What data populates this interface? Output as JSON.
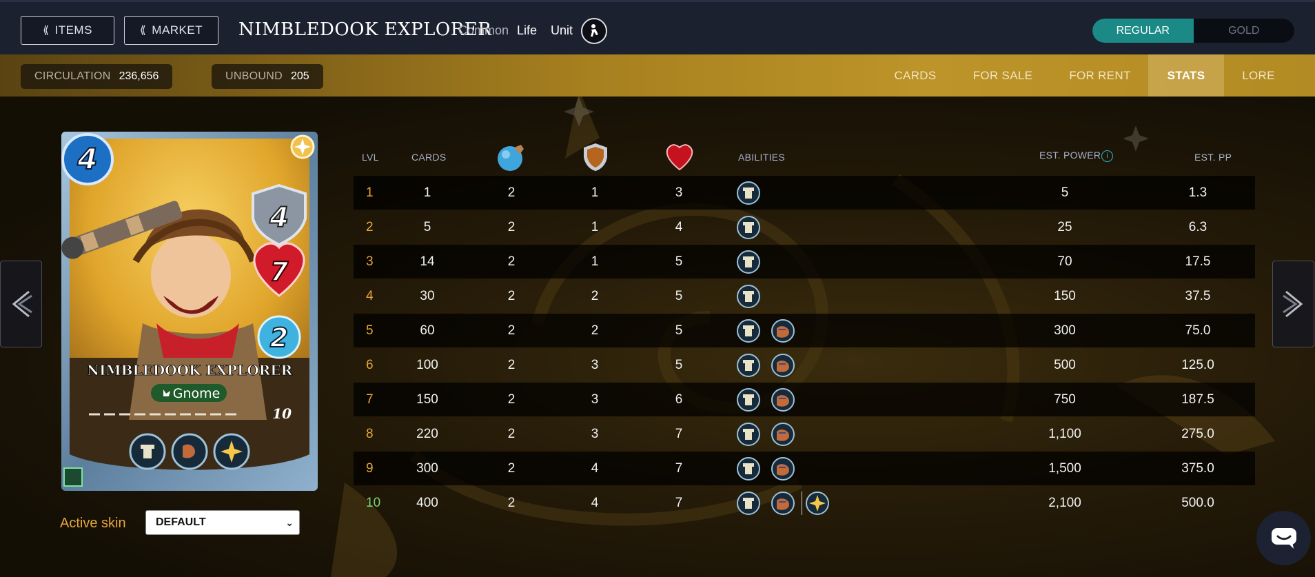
{
  "header": {
    "items_label": "ITEMS",
    "market_label": "MARKET",
    "card_name": "NIMBLEDOOK EXPLORER",
    "rarity": "Common",
    "element": "Life",
    "card_type": "Unit",
    "toggle": {
      "regular": "REGULAR",
      "gold": "GOLD",
      "selected": "REGULAR"
    }
  },
  "stats_bar": {
    "circulation_label": "CIRCULATION",
    "circulation_value": "236,656",
    "unbound_label": "UNBOUND",
    "unbound_value": "205"
  },
  "tabs": [
    {
      "label": "CARDS",
      "active": false
    },
    {
      "label": "FOR SALE",
      "active": false
    },
    {
      "label": "FOR RENT",
      "active": false
    },
    {
      "label": "STATS",
      "active": true
    },
    {
      "label": "LORE",
      "active": false
    }
  ],
  "card": {
    "mana": "4",
    "armor": "4",
    "health": "7",
    "speed": "2",
    "name": "NIMBLEDOOK EXPLORER",
    "race": "Gnome",
    "max_level": "10",
    "level_pips": 10
  },
  "skin": {
    "label": "Active skin",
    "selected": "DEFAULT"
  },
  "table": {
    "headers": {
      "lvl": "LVL",
      "cards": "CARDS",
      "abilities": "ABILITIES",
      "est_power": "EST. POWER",
      "est_pp": "EST. PP"
    },
    "header_icons": [
      "speed-icon",
      "armor-icon",
      "health-icon"
    ],
    "rows": [
      {
        "lvl": "1",
        "cards": "1",
        "speed": "2",
        "armor": "1",
        "health": "3",
        "abilities": 1,
        "power": "5",
        "pp": "1.3"
      },
      {
        "lvl": "2",
        "cards": "5",
        "speed": "2",
        "armor": "1",
        "health": "4",
        "abilities": 1,
        "power": "25",
        "pp": "6.3"
      },
      {
        "lvl": "3",
        "cards": "14",
        "speed": "2",
        "armor": "1",
        "health": "5",
        "abilities": 1,
        "power": "70",
        "pp": "17.5"
      },
      {
        "lvl": "4",
        "cards": "30",
        "speed": "2",
        "armor": "2",
        "health": "5",
        "abilities": 1,
        "power": "150",
        "pp": "37.5"
      },
      {
        "lvl": "5",
        "cards": "60",
        "speed": "2",
        "armor": "2",
        "health": "5",
        "abilities": 2,
        "power": "300",
        "pp": "75.0"
      },
      {
        "lvl": "6",
        "cards": "100",
        "speed": "2",
        "armor": "3",
        "health": "5",
        "abilities": 2,
        "power": "500",
        "pp": "125.0"
      },
      {
        "lvl": "7",
        "cards": "150",
        "speed": "2",
        "armor": "3",
        "health": "6",
        "abilities": 2,
        "power": "750",
        "pp": "187.5"
      },
      {
        "lvl": "8",
        "cards": "220",
        "speed": "2",
        "armor": "3",
        "health": "7",
        "abilities": 2,
        "power": "1,100",
        "pp": "275.0"
      },
      {
        "lvl": "9",
        "cards": "300",
        "speed": "2",
        "armor": "4",
        "health": "7",
        "abilities": 2,
        "power": "1,500",
        "pp": "375.0"
      },
      {
        "lvl": "10",
        "cards": "400",
        "speed": "2",
        "armor": "4",
        "health": "7",
        "abilities": 3,
        "power": "2,100",
        "pp": "500.0"
      }
    ]
  },
  "icons": {
    "ability_1": "fortress-ability-icon",
    "ability_2": "gauntlet-ability-icon",
    "ability_3": "sparkle-ability-icon"
  },
  "colors": {
    "accent_teal": "#1b8a86",
    "level_orange": "#e8a737",
    "max_level_green": "#7ed26c",
    "gold_bar": "#bd9429"
  }
}
